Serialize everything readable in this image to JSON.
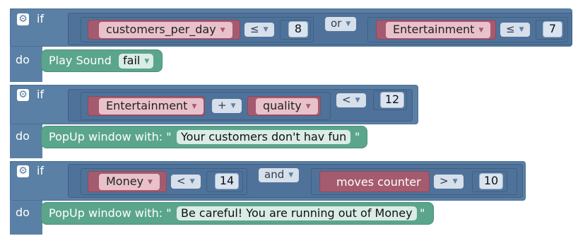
{
  "keywords": {
    "if": "if",
    "do": "do"
  },
  "gear_glyph": "⚙",
  "dropdown_glyph": "▼",
  "colors": {
    "if_block": "#5b80a5",
    "variable_block": "#a55b6f",
    "action_block": "#5ba58c"
  },
  "blocks": [
    {
      "condition": {
        "left": {
          "var": "customers_per_day",
          "op": "≤",
          "value": "8"
        },
        "logic": "or",
        "right": {
          "var": "Entertainment",
          "op": "≤",
          "value": "7"
        }
      },
      "action": {
        "label": "Play Sound",
        "value": "fail"
      }
    },
    {
      "condition": {
        "left": {
          "var": "Entertainment",
          "arith": "+",
          "var2": "quality"
        },
        "op": "<",
        "value": "12"
      },
      "action": {
        "prefix": "PopUp window with: \"",
        "text": "Your customers don't hav fun",
        "suffix": "\""
      }
    },
    {
      "condition": {
        "left": {
          "var": "Money",
          "op": "<",
          "value": "14"
        },
        "logic": "and",
        "right": {
          "var": "moves counter",
          "op": ">",
          "value": "10"
        }
      },
      "action": {
        "prefix": "PopUp window with: \"",
        "text": "Be careful! You are running out of Money",
        "suffix": "\""
      }
    }
  ]
}
